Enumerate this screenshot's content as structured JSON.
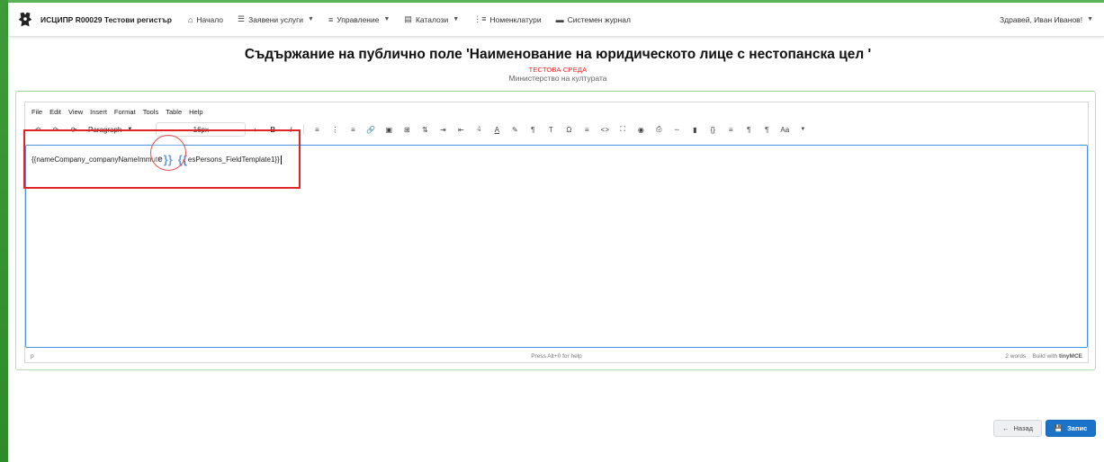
{
  "navbar": {
    "brand": "ИСЦИПР R00029 Тестови регистър",
    "items": [
      {
        "label": "Начало",
        "icon": "home-icon",
        "caret": false
      },
      {
        "label": "Заявени услуги",
        "icon": "layers-icon",
        "caret": true
      },
      {
        "label": "Управление",
        "icon": "list-icon",
        "caret": true
      },
      {
        "label": "Каталози",
        "icon": "catalog-icon",
        "caret": true
      },
      {
        "label": "Номенклатури",
        "icon": "list-ul-icon",
        "caret": false
      },
      {
        "label": "Системен журнал",
        "icon": "journal-icon",
        "caret": false
      }
    ],
    "user": "Здравей, Иван Иванов!"
  },
  "page": {
    "title": "Съдържание на публично поле 'Наименование на юридическото лице с нестопанска цел '",
    "environment": "ТЕСТОВА СРЕДА",
    "ministry": "Министерство на културата"
  },
  "editor": {
    "menu": [
      "File",
      "Edit",
      "View",
      "Insert",
      "Format",
      "Tools",
      "Table",
      "Help"
    ],
    "block_format": "Paragraph",
    "font_size": "16px",
    "content": {
      "part1": "{{nameCompany_companyNameImmut",
      "part2": "e",
      "brace_close": "}}",
      "brace_open": "{{",
      "part3": "esPersons_FieldTemplate1}}"
    },
    "status": {
      "path": "p",
      "help": "Press Alt+0 for help",
      "words": "2 words",
      "built": "Build with",
      "brand": "tinyMCE"
    }
  },
  "buttons": {
    "back": "Назад",
    "save": "Запис"
  },
  "colors": {
    "accent": "#1a73c9",
    "highlight": "#e02424",
    "frame": "#3f9a3a"
  }
}
